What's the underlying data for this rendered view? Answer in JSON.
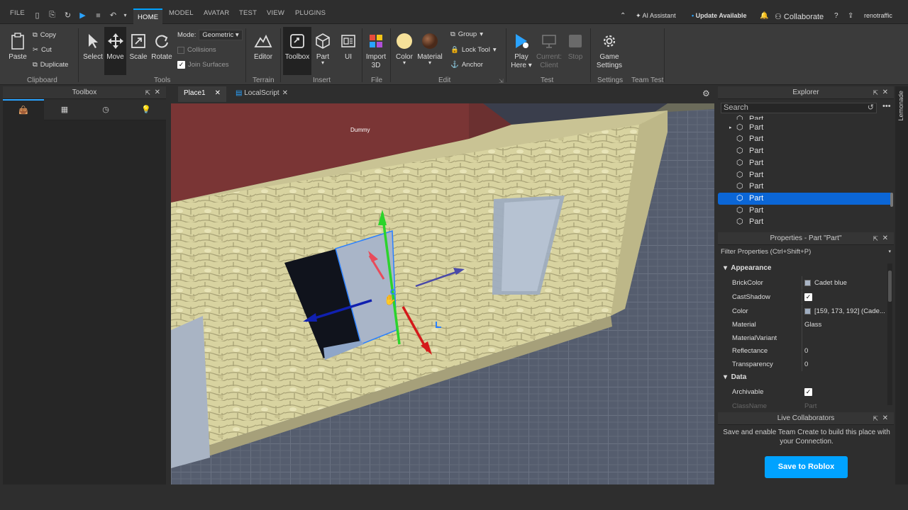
{
  "menu": {
    "file": "FILE",
    "tabs": [
      "HOME",
      "MODEL",
      "AVATAR",
      "TEST",
      "VIEW",
      "PLUGINS"
    ],
    "active_tab": "HOME"
  },
  "topright": {
    "ai": "AI Assistant",
    "update": "Update Available",
    "collaborate": "Collaborate",
    "user": "renotraffic"
  },
  "ribbon": {
    "clipboard": {
      "paste": "Paste",
      "copy": "Copy",
      "cut": "Cut",
      "duplicate": "Duplicate",
      "label": "Clipboard"
    },
    "tools": {
      "select": "Select",
      "move": "Move",
      "scale": "Scale",
      "rotate": "Rotate",
      "mode_label": "Mode:",
      "mode_value": "Geometric",
      "collisions": "Collisions",
      "join": "Join Surfaces",
      "label": "Tools"
    },
    "terrain": {
      "editor": "Editor",
      "label": "Terrain"
    },
    "insert": {
      "toolbox": "Toolbox",
      "part": "Part",
      "ui": "UI",
      "label": "Insert"
    },
    "file": {
      "import": "Import",
      "import2": "3D",
      "label": "File"
    },
    "edit": {
      "color": "Color",
      "material": "Material",
      "group": "Group",
      "lock": "Lock Tool",
      "anchor": "Anchor",
      "label": "Edit"
    },
    "test": {
      "play": "Play",
      "play2": "Here",
      "current": "Current:",
      "current2": "Client",
      "stop": "Stop",
      "label": "Test"
    },
    "settings": {
      "game": "Game",
      "game2": "Settings",
      "label": "Settings"
    },
    "teamtest": {
      "label": "Team Test"
    }
  },
  "toolbox": {
    "title": "Toolbox"
  },
  "tabs": {
    "place": "Place1",
    "script": "LocalScript"
  },
  "viewport": {
    "label": "Dummy"
  },
  "explorer": {
    "title": "Explorer",
    "search": "Search",
    "items": [
      "Part",
      "Part",
      "Part",
      "Part",
      "Part",
      "Part",
      "Part",
      "Part",
      "Part",
      "Part"
    ],
    "selected_index": 7
  },
  "properties": {
    "title": "Properties - Part \"Part\"",
    "filter": "Filter Properties (Ctrl+Shift+P)",
    "appearance": "Appearance",
    "rows": [
      {
        "k": "BrickColor",
        "v": "Cadet blue",
        "type": "swatch",
        "color": "#a9b4c4"
      },
      {
        "k": "CastShadow",
        "v": "✓",
        "type": "check"
      },
      {
        "k": "Color",
        "v": "[159, 173, 192] (Cade...",
        "type": "swatch",
        "color": "#9fadc0"
      },
      {
        "k": "Material",
        "v": "Glass",
        "type": "text"
      },
      {
        "k": "MaterialVariant",
        "v": "",
        "type": "text"
      },
      {
        "k": "Reflectance",
        "v": "0",
        "type": "text"
      },
      {
        "k": "Transparency",
        "v": "0",
        "type": "text"
      }
    ],
    "data": "Data",
    "archivable": "Archivable",
    "archivable_v": "✓",
    "classname": "ClassName",
    "classname_v": "Part"
  },
  "collab": {
    "title": "Live Collaborators",
    "msg": "Save and enable Team Create to build this place with your Connection.",
    "button": "Save to Roblox"
  },
  "sidebar": {
    "lemonade": "Lemonade"
  }
}
